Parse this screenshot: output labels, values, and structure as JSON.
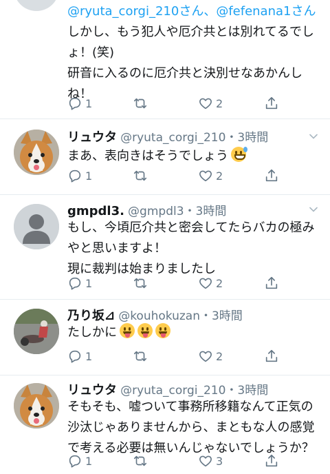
{
  "tweets": [
    {
      "mention": "@ryuta_corgi_210さん、@fefenana1さん",
      "body": "しかし、もう犯人や厄介共とは別れてるでし\nょ！(笑)\n研音に入るのに厄介共と決別せなあかんし\nね！",
      "reply_count": "1",
      "like_count": "2"
    },
    {
      "name": "リュウタ",
      "handle": "@ryuta_corgi_210・3時間",
      "body": "まあ、表向きはそうでしょう",
      "emoji": "grinning-sweat-emoji",
      "reply_count": "1",
      "like_count": "2"
    },
    {
      "name": "gmpdl3.",
      "handle": "@gmpdl3・3時間",
      "body": "もし、今頃厄介共と密会してたらバカの極み\nやと思いますよ！\n現に裁判は始まりましたし",
      "reply_count": "1",
      "like_count": "2"
    },
    {
      "name": "乃り坂⊿",
      "handle": "@kouhokuzan・3時間",
      "body": "たしかに",
      "emoji": "tongue-out-emoji",
      "reply_count": "1",
      "like_count": "2"
    },
    {
      "name": "リュウタ",
      "handle": "@ryuta_corgi_210・3時間",
      "body": "そもそも、嘘ついて事務所移籍なんて正気の\n沙汰じゃありませんから、まともな人の感覚\nで考える必要は無いんじゃないでしょうか？",
      "reply_count": "1",
      "like_count": "3"
    }
  ],
  "colors": {
    "accent": "#1da1f2",
    "muted": "#657786",
    "divider": "#e6ecf0"
  },
  "icons": [
    "reply-icon",
    "retweet-icon",
    "like-icon",
    "share-icon",
    "caret-down-icon"
  ]
}
